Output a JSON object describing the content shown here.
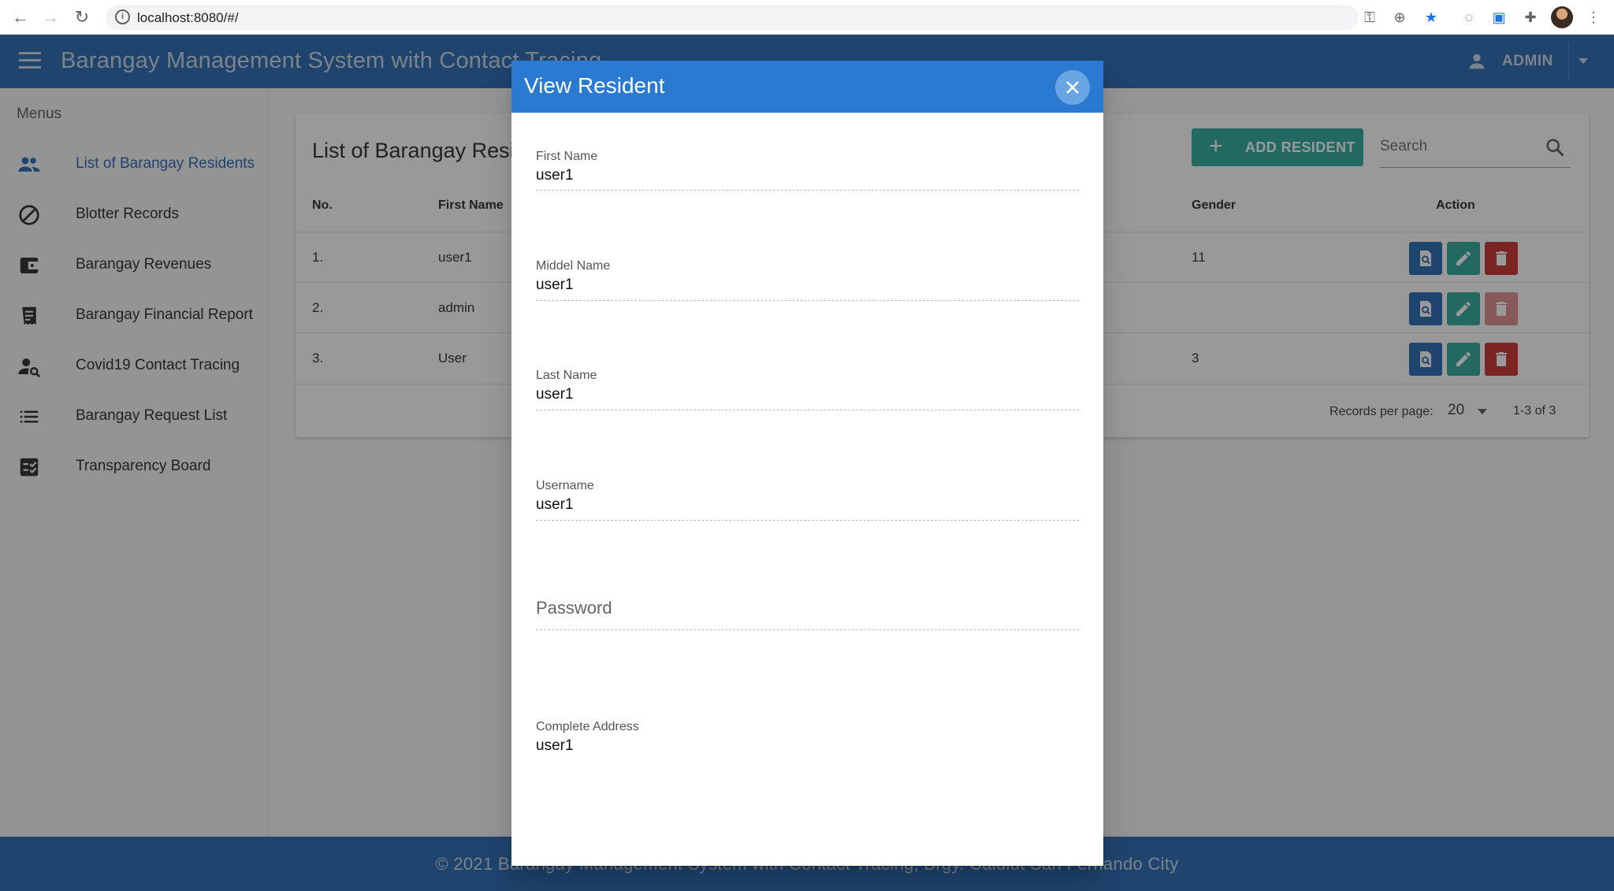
{
  "browser": {
    "url": "localhost:8080/#/"
  },
  "header": {
    "title": "Barangay Management System with Contact Tracing",
    "user_label": "ADMIN",
    "color": "#1e62b0"
  },
  "sidebar": {
    "heading": "Menus",
    "items": [
      {
        "label": "List of Barangay Residents",
        "icon": "people-icon",
        "active": true
      },
      {
        "label": "Blotter Records",
        "icon": "block-icon"
      },
      {
        "label": "Barangay Revenues",
        "icon": "wallet-icon"
      },
      {
        "label": "Barangay Financial Report",
        "icon": "receipt-icon"
      },
      {
        "label": "Covid19 Contact Tracing",
        "icon": "person-search-icon"
      },
      {
        "label": "Barangay Request List",
        "icon": "list-icon"
      },
      {
        "label": "Transparency Board",
        "icon": "checklist-icon"
      }
    ]
  },
  "main": {
    "card_title": "List of Barangay Residents",
    "add_button_label": "ADD RESIDENT",
    "search_placeholder": "Search",
    "columns": [
      "No.",
      "First Name",
      "Gender",
      "Action"
    ],
    "rows": [
      {
        "no": "1.",
        "first_name": "user1",
        "gender": "11",
        "delete_enabled": true
      },
      {
        "no": "2.",
        "first_name": "admin",
        "gender": "",
        "delete_enabled": false
      },
      {
        "no": "3.",
        "first_name": "User",
        "gender": "3",
        "delete_enabled": true
      }
    ],
    "records_per_page_label": "Records per page:",
    "records_per_page_value": "20",
    "range_text": "1-3 of 3"
  },
  "footer": {
    "text": "© 2021 Barangay Management System with Contact Tracing, Brgy. Calulut San Fernando City"
  },
  "dialog": {
    "title": "View Resident",
    "fields": [
      {
        "label": "First Name",
        "value": "user1"
      },
      {
        "label": "Middel Name",
        "value": "user1"
      },
      {
        "label": "Last Name",
        "value": "user1"
      },
      {
        "label": "Username",
        "value": "user1"
      },
      {
        "label": "Password",
        "value": ""
      },
      {
        "label": "Complete Address",
        "value": "user1"
      }
    ]
  },
  "colors": {
    "primary": "#1e62b0",
    "dialog_header": "#2a7ad2",
    "teal": "#26a69a",
    "danger": "#c62828"
  }
}
